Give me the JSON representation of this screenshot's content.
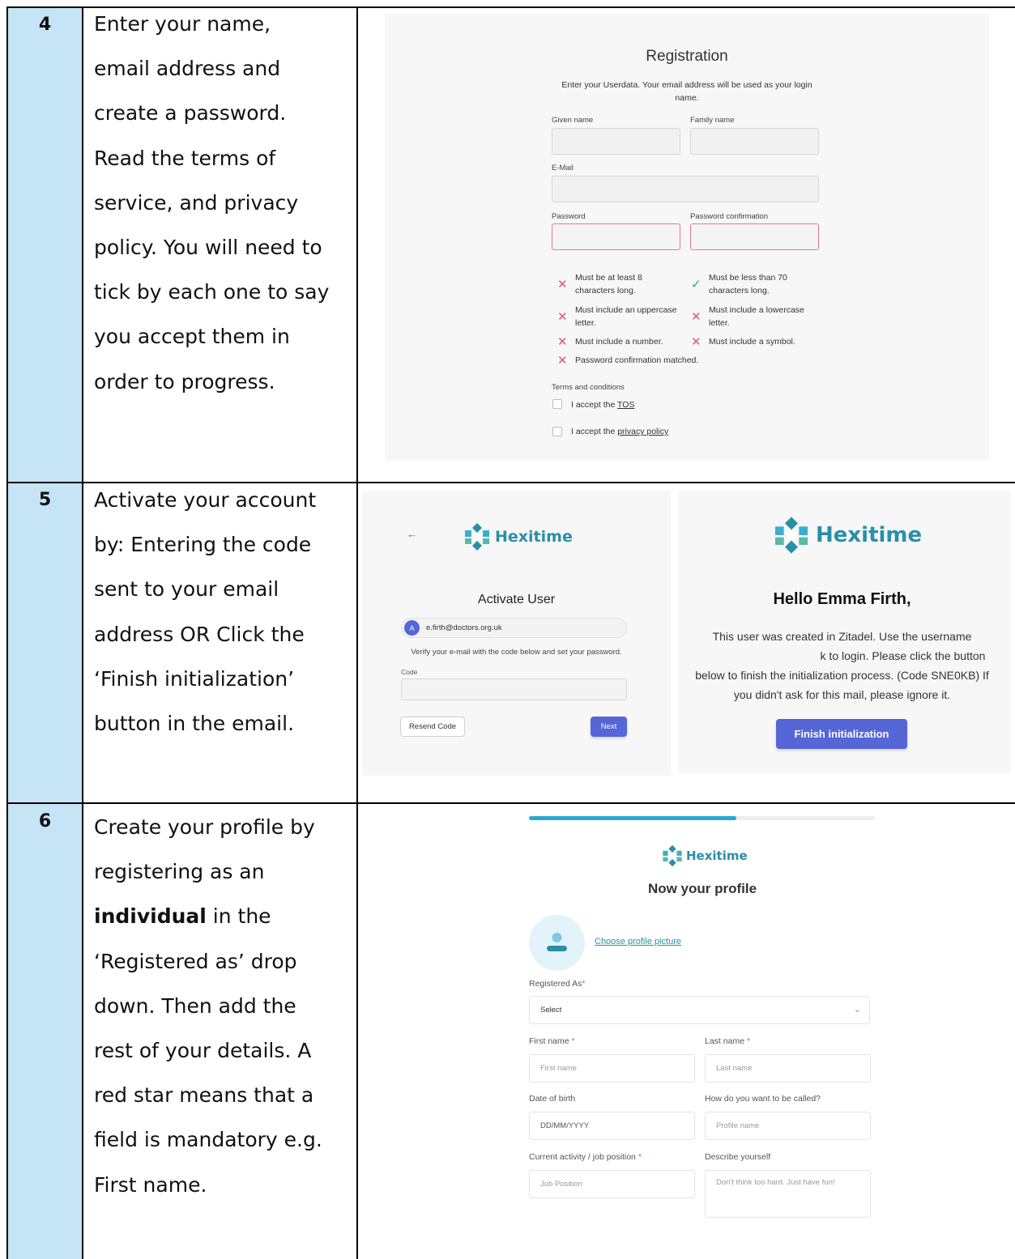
{
  "steps": [
    {
      "number": "4",
      "instruction_lines": [
        "Enter your name,",
        "email address and",
        "create a password.",
        "Read the terms of",
        "service, and privacy",
        "policy. You will need to",
        "tick by each one to say",
        "you accept them in",
        "order to progress."
      ]
    },
    {
      "number": "5",
      "instruction_lines": [
        "Activate your account",
        "by: Entering the code",
        "sent to your email",
        "address OR Click the",
        "‘Finish initialization’",
        "button in the email."
      ]
    },
    {
      "number": "6",
      "instruction_lines_pre": [
        "Create your profile by",
        "registering as an"
      ],
      "bold_word": "individual",
      "after_bold": " in the",
      "instruction_lines_post": [
        "‘Registered as’ drop",
        "down.  Then add the",
        "rest of your details. A",
        "red star means that a",
        "field is mandatory e.g.",
        "First name."
      ]
    }
  ],
  "registration": {
    "title": "Registration",
    "intro_line1": "Enter your Userdata. Your email address will be used as your login",
    "intro_line2": "name.",
    "given_name_label": "Given name",
    "family_name_label": "Family name",
    "email_label": "E-Mail",
    "password_label": "Password",
    "password_confirm_label": "Password confirmation",
    "requirements": [
      {
        "line1": "Must be at least 8",
        "line2": "characters long.",
        "met": false
      },
      {
        "line1": "Must be less than 70",
        "line2": "characters long.",
        "met": true
      },
      {
        "line1": "Must include an uppercase",
        "line2": "letter.",
        "met": false
      },
      {
        "line1": "Must include a lowercase",
        "line2": "letter.",
        "met": false
      },
      {
        "line1": "Must include a number.",
        "line2": "",
        "met": false
      },
      {
        "line1": "Must include a symbol.",
        "line2": "",
        "met": false
      },
      {
        "line1": "Password confirmation matched.",
        "line2": "",
        "met": false
      }
    ],
    "terms_heading": "Terms and conditions",
    "tos_prefix": "I accept the ",
    "tos_link": "TOS",
    "privacy_prefix": "I accept the ",
    "privacy_link": "privacy policy"
  },
  "activate": {
    "back_arrow": "←",
    "brand": "Hexitime",
    "title": "Activate User",
    "avatar_letter": "A",
    "email": "e.firth@doctors.org.uk",
    "verify_text": "Verify your e-mail with the code below and set your password.",
    "code_label": "Code",
    "resend_label": "Resend Code",
    "next_label": "Next"
  },
  "email": {
    "brand": "Hexitime",
    "greeting": "Hello Emma Firth,",
    "body_line1": "This user was created in Zitadel. Use the username",
    "body_line2": "k to login. Please click the button",
    "body_line3": "below to finish the initialization process. (Code SNE0KB) If",
    "body_line4": "you didn't ask for this mail, please ignore it.",
    "button_label": "Finish initialization"
  },
  "profile": {
    "progress": 0.6,
    "brand": "Hexitime",
    "title": "Now your profile",
    "choose_picture": "Choose profile picture",
    "registered_as_label": "Registered As",
    "registered_as_value": "Select",
    "first_name_label": "First name",
    "first_name_placeholder": "First name",
    "last_name_label": "Last name",
    "last_name_placeholder": "Last name",
    "dob_label": "Date of birth",
    "dob_placeholder": "DD/MM/YYYY",
    "called_label": "How do you want to be called?",
    "called_placeholder": "Profile name",
    "job_label": "Current activity / job position",
    "job_placeholder": "Job Position",
    "describe_label": "Describe yourself",
    "describe_placeholder": "Don't think too hard. Just have fun!",
    "star": "*"
  },
  "colors": {
    "number_column": "#c5e4f5",
    "brand_teal": "#2a8fa7",
    "primary_button": "#5466d8",
    "error": "#e0576b",
    "success": "#3aa361",
    "progress": "#2ba8d2"
  }
}
